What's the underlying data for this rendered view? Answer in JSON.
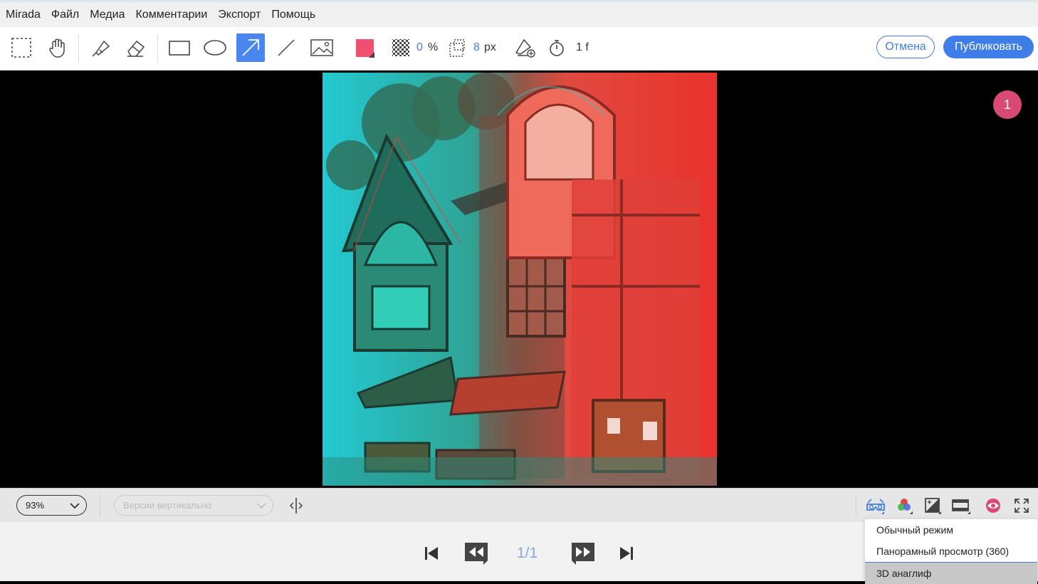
{
  "menu": [
    "Mirada",
    "Файл",
    "Медиа",
    "Комментарии",
    "Экспорт",
    "Помощь"
  ],
  "toolbar": {
    "color_swatch": "#f05070",
    "opacity_value": "0",
    "opacity_unit": "%",
    "size_value": "8",
    "size_unit": "px",
    "duration_value": "1 f",
    "cancel_label": "Отмена",
    "publish_label": "Публиковать"
  },
  "viewer": {
    "badge": "1"
  },
  "statusbar": {
    "zoom": "93%",
    "versions_placeholder": "Версии вертикально"
  },
  "playback": {
    "page": "1/1"
  },
  "view_mode_menu": {
    "items": [
      "Обычный режим",
      "Панорамный просмотр (360)",
      "3D анаглиф"
    ],
    "selected": "3D анаглиф"
  },
  "colors": {
    "accent": "#3f7ee8",
    "badge": "#d94a73"
  }
}
